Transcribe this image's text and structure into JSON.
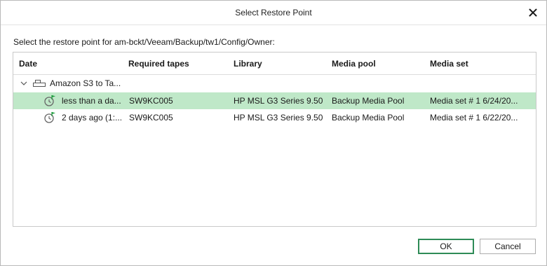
{
  "dialog": {
    "title": "Select Restore Point",
    "instruction": "Select the restore point for am-bckt/Veeam/Backup/tw1/Config/Owner:",
    "close_icon": "close-icon"
  },
  "grid": {
    "columns": [
      "Date",
      "Required tapes",
      "Library",
      "Media pool",
      "Media set"
    ],
    "group": {
      "label": "Amazon S3 to Ta...",
      "expanded": true,
      "icon": "tape-job-icon"
    },
    "rows": [
      {
        "date": "less than a da...",
        "tapes": "SW9KC005",
        "library": "HP MSL G3 Series 9.50",
        "pool": "Backup Media Pool",
        "set": "Media set # 1 6/24/20...",
        "selected": true,
        "icon": "restore-point-clock-icon"
      },
      {
        "date": "2 days ago (1:...",
        "tapes": "SW9KC005",
        "library": "HP MSL G3 Series 9.50",
        "pool": "Backup Media Pool",
        "set": "Media set # 1 6/22/20...",
        "selected": false,
        "icon": "restore-point-clock-icon"
      }
    ]
  },
  "buttons": {
    "ok": "OK",
    "cancel": "Cancel"
  },
  "colors": {
    "selected_row": "#bfe8c8",
    "accent_green": "#2e8b57",
    "flag_green": "#1a9a3a"
  }
}
